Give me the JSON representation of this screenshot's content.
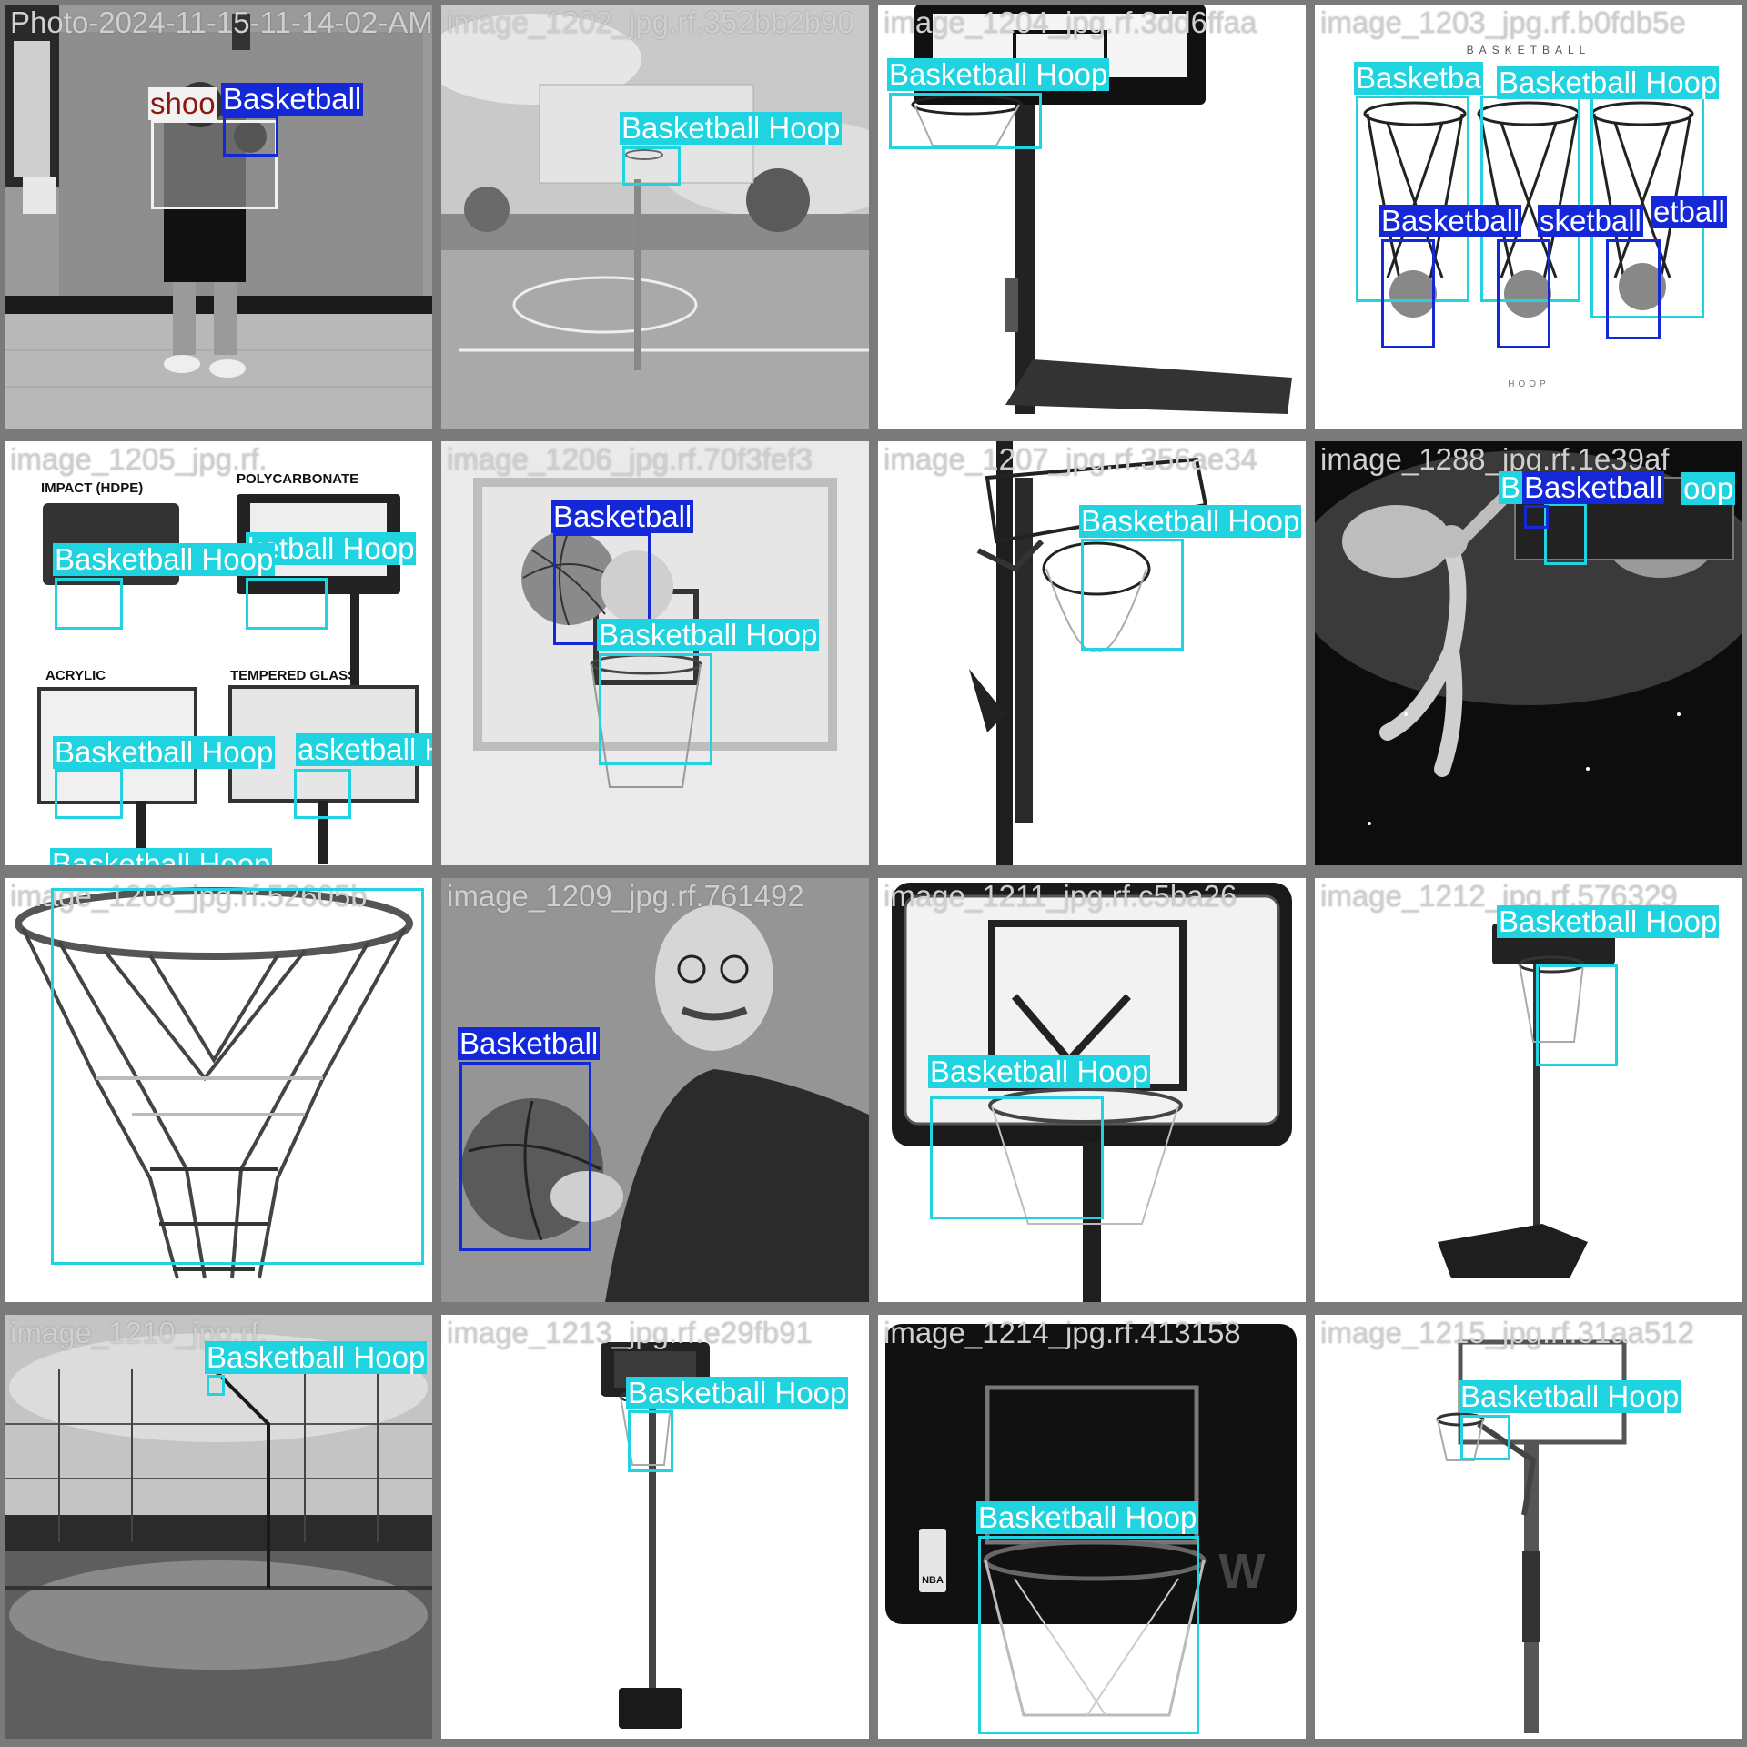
{
  "tiles": [
    {
      "filename": "Photo-2024-11-15-11-14-02-AM",
      "labels": [
        "shoo",
        "Basketball"
      ],
      "classes": [
        "shoot",
        "ball"
      ]
    },
    {
      "filename": "image_1202_jpg.rf.352bb2b90",
      "labels": [
        "Basketball Hoop"
      ],
      "classes": [
        "hoop"
      ]
    },
    {
      "filename": "image_1204_jpg.rf.3dd6ffaa",
      "labels": [
        "Basketball Hoop"
      ],
      "classes": [
        "hoop"
      ]
    },
    {
      "filename": "image_1203_jpg.rf.b0fdb5e",
      "labels": [
        "Basketba",
        "Basketball Hoop",
        "Basketball",
        "sketball",
        "etball"
      ],
      "classes": [
        "hoop",
        "hoop",
        "ball",
        "ball",
        "ball"
      ]
    },
    {
      "filename": "image_1205_jpg.rf.",
      "labels": [
        "Basketball Hoop",
        "ketball Hoop",
        "Basketball Hoop",
        "asketball Hoop",
        "Basketball Hoop"
      ],
      "classes": [
        "hoop",
        "hoop",
        "hoop",
        "hoop",
        "hoop"
      ]
    },
    {
      "filename": "image_1206_jpg.rf.70f3fef3",
      "labels": [
        "Basketball",
        "Basketball Hoop"
      ],
      "classes": [
        "ball",
        "hoop"
      ]
    },
    {
      "filename": "image_1207_jpg.rf.356ae34",
      "labels": [
        "Basketball Hoop"
      ],
      "classes": [
        "hoop"
      ]
    },
    {
      "filename": "image_1288_jpg.rf.1e39af",
      "labels": [
        "B",
        "Basketball",
        "oop"
      ],
      "classes": [
        "hoop",
        "ball",
        "hoop"
      ]
    },
    {
      "filename": "image_1208_jpg.rf.52605b",
      "labels": [],
      "classes": []
    },
    {
      "filename": "image_1209_jpg.rf.761492",
      "labels": [
        "Basketball"
      ],
      "classes": [
        "ball"
      ]
    },
    {
      "filename": "image_1211_jpg.rf.c5ba26",
      "labels": [
        "Basketball Hoop"
      ],
      "classes": [
        "hoop"
      ]
    },
    {
      "filename": "image_1212_jpg.rf.576329",
      "labels": [
        "Basketball Hoop"
      ],
      "classes": [
        "hoop"
      ]
    },
    {
      "filename": "image_1210_jpg.rf.",
      "labels": [
        "Basketball Hoop"
      ],
      "classes": [
        "hoop"
      ]
    },
    {
      "filename": "image_1213_jpg.rf.e29fb91",
      "labels": [
        "Basketball Hoop"
      ],
      "classes": [
        "hoop"
      ]
    },
    {
      "filename": "image_1214_jpg.rf.413158",
      "labels": [
        "Basketball Hoop"
      ],
      "classes": [
        "hoop"
      ]
    },
    {
      "filename": "image_1215_jpg.rf.31aa512",
      "labels": [
        "Basketball Hoop"
      ],
      "classes": [
        "hoop"
      ]
    }
  ],
  "photo_text": {
    "t4_top": "BASKETBALL",
    "t4_bottom": "HOOP",
    "t5_impact": "IMPACT (HDPE)",
    "t5_poly": "POLYCARBONATE",
    "t5_acrylic": "ACRYLIC",
    "t5_glass": "TEMPERED GLASS",
    "t15_nba": "NBA",
    "t15_brand": "W"
  },
  "colors": {
    "hoop": "#1fd3e0",
    "ball": "#1428d8",
    "shoot": "#f2f2f2",
    "grid": "#7a7a7a"
  }
}
